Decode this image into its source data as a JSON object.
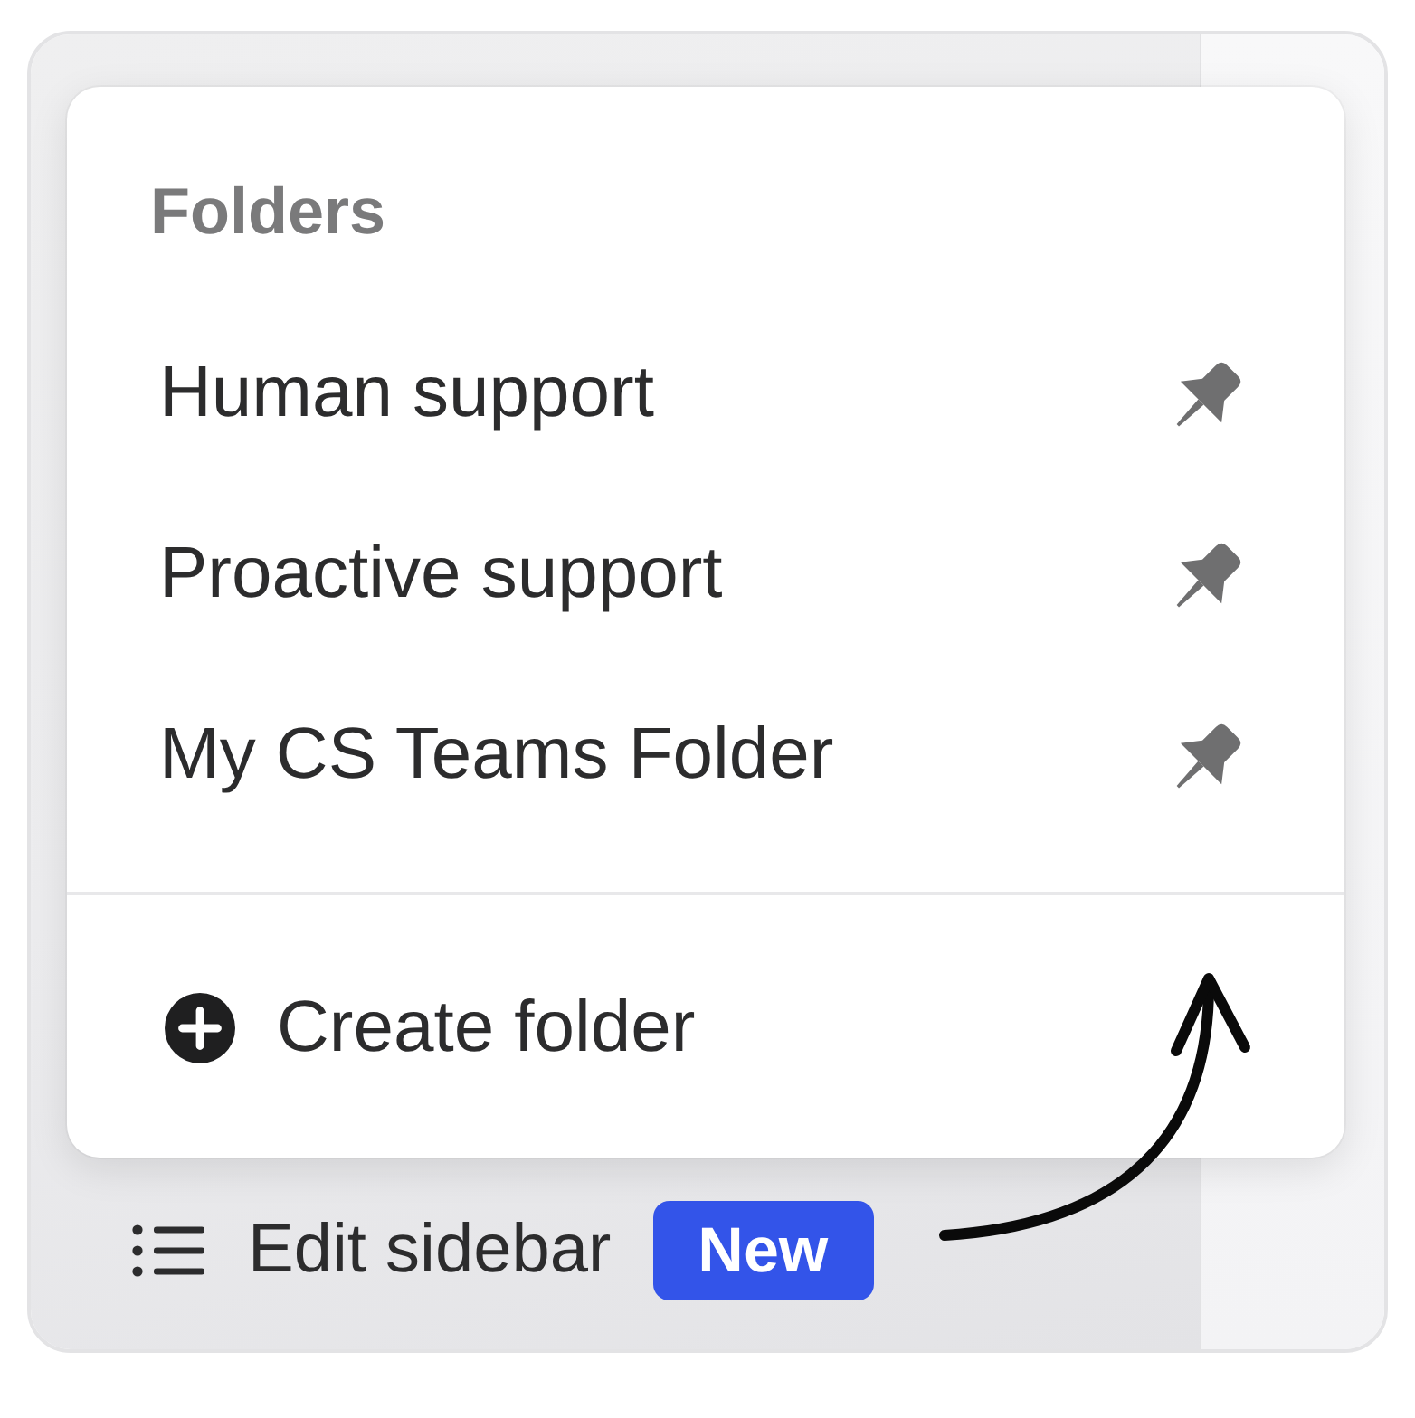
{
  "menu": {
    "heading": "Folders",
    "folders": [
      {
        "label": "Human support"
      },
      {
        "label": "Proactive support"
      },
      {
        "label": "My CS Teams Folder"
      }
    ],
    "create_action": {
      "label": "Create folder"
    }
  },
  "sidebar_footer": {
    "edit_label": "Edit sidebar",
    "badge": "New"
  }
}
